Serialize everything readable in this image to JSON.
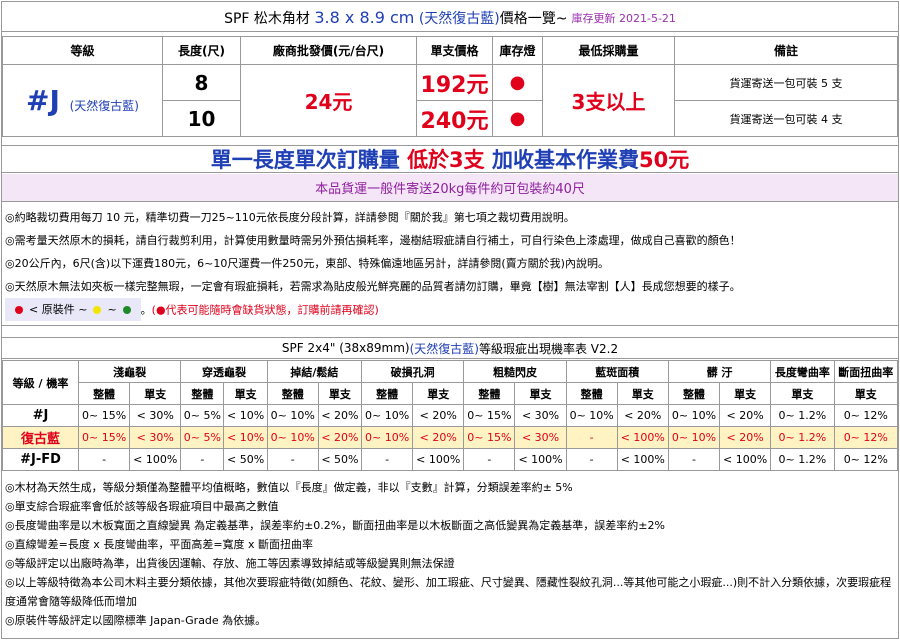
{
  "title": {
    "prefix": "SPF  松木角材",
    "size": "3.8 x 8.9 cm",
    "color": "(天然復古藍)",
    "suffix": "價格一覽~",
    "updated": "庫存更新 2021-5-21"
  },
  "price_table": {
    "headers": [
      "等級",
      "長度(尺)",
      "廠商批發價(元/台尺)",
      "單支價格",
      "庫存燈",
      "最低採購量",
      "備註"
    ],
    "grade": "#J",
    "grade_sub": "(天然復古藍)",
    "wholesale": "24元",
    "min_order": "3支以上",
    "rows": [
      {
        "length": "8",
        "price": "192元",
        "stock": "●",
        "remark": "貨運寄送一包可裝 5 支"
      },
      {
        "length": "10",
        "price": "240元",
        "stock": "●",
        "remark": "貨運寄送一包可裝 4 支"
      }
    ]
  },
  "banner": {
    "part1": "單一長度單次訂購量",
    "part2": "低於3支",
    "part3": "加收基本作業費",
    "part4": "50元"
  },
  "shipping_note": "本品貨運一般件寄送20kg每件約可包裝約40尺",
  "notes": [
    "◎約略裁切費用每刀 10 元，精準切費一刀25~110元依長度分段計算，詳請參閱『關於我』第七項之裁切費用說明。",
    "◎需考量天然原木的損耗，請自行裁剪利用，計算使用數量時需另外預估損耗率，邊樹結瑕疵請自行補土，可自行染色上漆處理，做成自己喜歡的顏色！",
    "◎20公斤內，6尺(含)以下運費180元，6~10尺運費一件250元，東部、特殊偏遠地區另計，詳請參閱(賣方關於我)內說明。",
    "◎天然原木無法如夾板一樣完整無瑕，一定會有瑕疵損耗，若需求為貼皮般光鮮亮麗的品質者請勿訂購，畢竟【樹】無法宰割【人】長成您想要的樣子。"
  ],
  "legend": {
    "label": "< 原裝件  ~",
    "sep": "~",
    "tail": "。",
    "warning": "(●代表可能隨時會缺貨狀態，訂購前請再確認)",
    "colors": {
      "red": "#e0001b",
      "yellow": "#f2e600",
      "green": "#1e8a2a"
    }
  },
  "defect_title": {
    "prefix": "SPF 2x4\" (38x89mm)",
    "color": "(天然復古藍)",
    "suffix": "等級瑕疵出現機率表 V2.2"
  },
  "defect_table": {
    "corner": "等級 / 機率",
    "groups": [
      "淺龜裂",
      "穿透龜裂",
      "掉結/鬆結",
      "破損孔洞",
      "粗糙閃皮",
      "藍斑面積",
      "髒 汙",
      "長度彎曲率",
      "斷面扭曲率"
    ],
    "sub_full": "整體",
    "sub_single": "單支",
    "rows": [
      {
        "grade": "#J",
        "values": [
          "0~ 15%",
          "< 30%",
          "0~ 5%",
          "< 10%",
          "0~ 10%",
          "< 20%",
          "0~ 10%",
          "< 20%",
          "0~ 15%",
          "< 30%",
          "0~ 10%",
          "< 20%",
          "0~ 10%",
          "< 20%",
          "0~ 1.2%",
          "0~ 12%"
        ]
      },
      {
        "grade": "復古藍",
        "values": [
          "0~ 15%",
          "< 30%",
          "0~ 5%",
          "< 10%",
          "0~ 10%",
          "< 20%",
          "0~ 10%",
          "< 20%",
          "0~ 15%",
          "< 30%",
          "-",
          "< 100%",
          "0~ 10%",
          "< 20%",
          "0~ 1.2%",
          "0~ 12%"
        ]
      },
      {
        "grade": "#J-FD",
        "values": [
          "-",
          "< 100%",
          "-",
          "< 50%",
          "-",
          "< 50%",
          "-",
          "< 100%",
          "-",
          "< 100%",
          "-",
          "< 100%",
          "-",
          "< 100%",
          "0~ 1.2%",
          "0~ 12%"
        ]
      }
    ]
  },
  "footnotes": [
    "◎木材為天然生成，等級分類僅為整體平均值概略，數值以『長度』做定義，非以『支數』計算，分類誤差率約± 5%",
    "◎單支綜合瑕疵率會低於該等級各瑕疵項目中最高之數值",
    "◎長度彎曲率是以木板寬面之直線變異 為定義基準，誤差率約±0.2%，斷面扭曲率是以木板斷面之高低變異為定義基準，誤差率約±2%",
    "◎直線彎差=長度 x 長度彎曲率，平面高差=寬度 x 斷面扭曲率",
    "◎等級評定以出廠時為準，出貨後因運輸、存放、施工等因素導致掉結或等級變異則無法保證",
    "◎以上等級特徵為本公司木料主要分類依據，其他次要瑕疵特徵(如顏色、花紋、變形、加工瑕疵、尺寸變異、隱藏性裂紋孔洞...等其他可能之小瑕疵...)則不計入分類依據，次要瑕疵程度通常會隨等級降低而增加",
    "◎原裝件等級評定以國際標準 Japan-Grade 為依據。"
  ]
}
